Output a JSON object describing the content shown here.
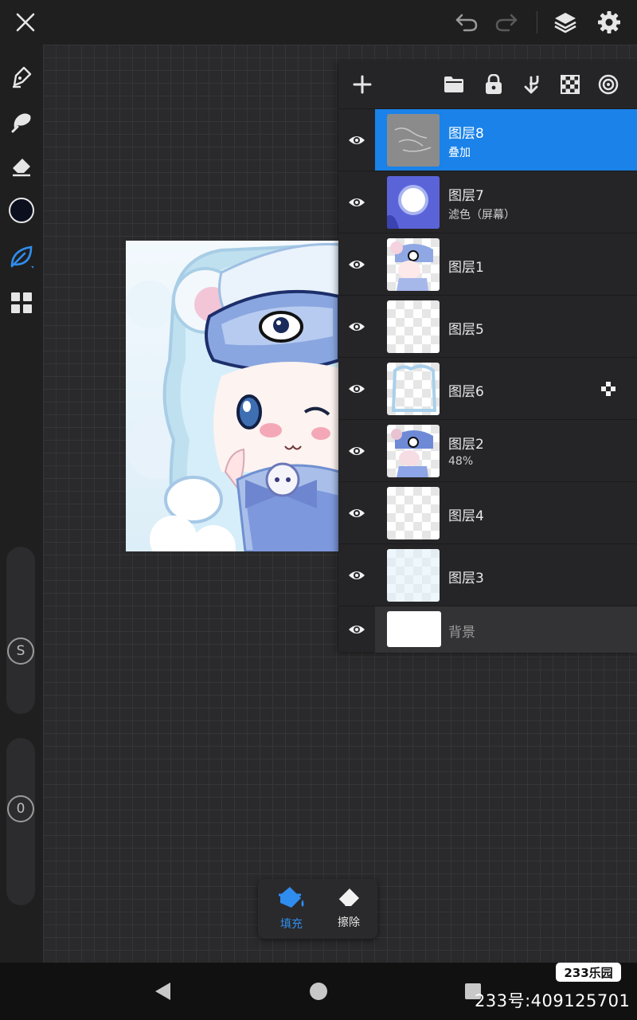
{
  "topbar": {
    "icons": [
      "close-icon",
      "undo-icon",
      "redo-icon",
      "layers-icon",
      "settings-icon"
    ]
  },
  "left_toolbar": {
    "icons": [
      "pen-icon",
      "smudge-icon",
      "eraser-icon",
      "color-swatch",
      "leaf-brush-icon",
      "grid-icon"
    ],
    "color": "#0b0f1e",
    "size_slider_label": "S",
    "opacity_slider_label": "0"
  },
  "layers_panel": {
    "toolbar_icons": [
      "add-layer-icon",
      "folder-icon",
      "lock-icon",
      "merge-down-icon",
      "checkerboard-icon",
      "target-icon"
    ],
    "layers": [
      {
        "name": "图层8",
        "mode": "叠加",
        "selected": true
      },
      {
        "name": "图层7",
        "mode": "滤色（屏幕）",
        "selected": false
      },
      {
        "name": "图层1",
        "mode": "",
        "selected": false
      },
      {
        "name": "图层5",
        "mode": "",
        "selected": false
      },
      {
        "name": "图层6",
        "mode": "",
        "selected": false,
        "alpha_lock": true
      },
      {
        "name": "图层2",
        "mode": "48%",
        "selected": false
      },
      {
        "name": "图层4",
        "mode": "",
        "selected": false
      },
      {
        "name": "图层3",
        "mode": "",
        "selected": false
      }
    ],
    "background_label": "背景"
  },
  "fill_popup": {
    "fill_label": "填充",
    "erase_label": "擦除",
    "accent_color": "#2f8df0"
  },
  "watermark": {
    "logo_text": "233乐园",
    "id_text": "233号:409125701"
  }
}
